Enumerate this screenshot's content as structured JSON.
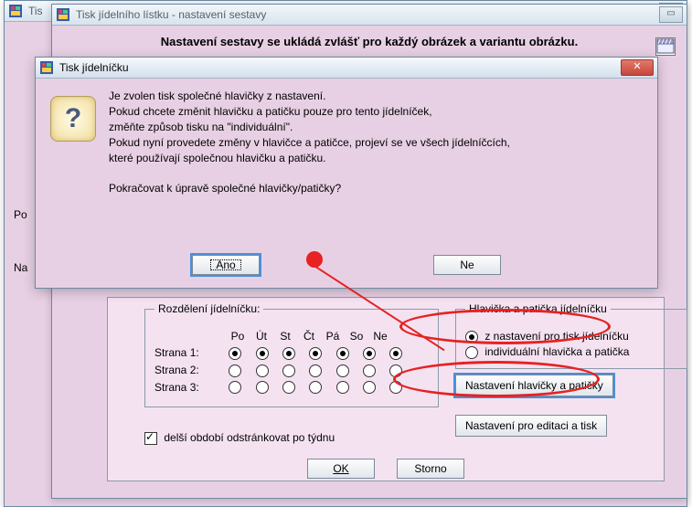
{
  "bg_window": {
    "title": "Tis"
  },
  "main_window": {
    "title": "Tisk jídelního lístku - nastavení sestavy"
  },
  "banner": "Nastavení sestavy se ukládá zvlášť pro každý obrázek a variantu obrázku.",
  "side": {
    "po": "Po",
    "na": "Na"
  },
  "schedule": {
    "legend": "Rozdělení jídelníčku:",
    "days": [
      "Po",
      "Út",
      "St",
      "Čt",
      "Pá",
      "So",
      "Ne"
    ],
    "rows": [
      "Strana 1:",
      "Strana 2:",
      "Strana 3:"
    ],
    "checkbox_label": "delší období odstránkovat po týdnu"
  },
  "right_group": {
    "legend": "Hlavička a patička jídelníčku",
    "opt1": "z nastavení pro tisk jídelníčku",
    "opt2": "individuální hlavička a patička",
    "btn_settings_hp": "Nastavení hlavičky a patičky",
    "btn_settings_edit": "Nastavení pro editaci a tisk"
  },
  "bottom": {
    "ok": "OK",
    "storno": "Storno"
  },
  "dialog": {
    "title": "Tisk jídelníčku",
    "line1": "Je zvolen tisk společné hlavičky z nastavení.",
    "line2": "Pokud chcete změnit hlavičku a patičku pouze pro tento jídelníček,",
    "line3": "změňte způsob tisku na \"individuální\".",
    "line4": "Pokud nyní provedete změny v hlavičce a patičce, projeví se ve všech jídelníčcích,",
    "line5": "které používají společnou hlavičku a patičku.",
    "line6": "Pokračovat k úpravě společné hlavičky/patičky?",
    "ano": "Ano",
    "ne": "Ne"
  },
  "icons": {
    "close_x": "✕",
    "box": "▭"
  }
}
